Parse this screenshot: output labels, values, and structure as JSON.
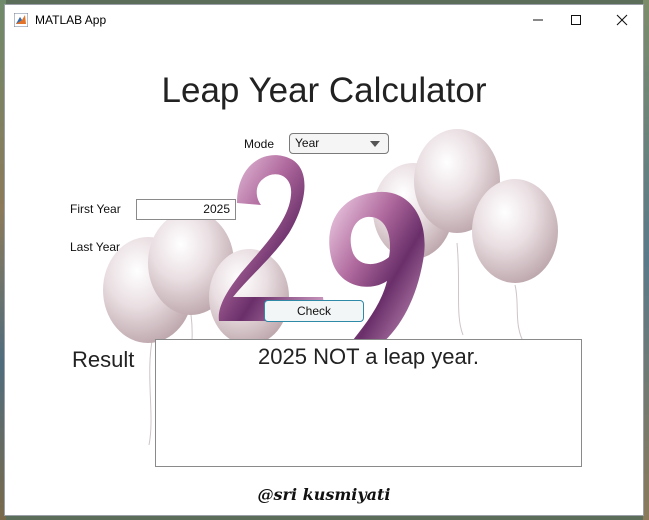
{
  "window": {
    "title": "MATLAB App",
    "controls": {
      "minimize": "minimize-icon",
      "maximize": "maximize-icon",
      "close": "close-icon"
    }
  },
  "app": {
    "title": "Leap Year Calculator",
    "mode": {
      "label": "Mode",
      "selected": "Year"
    },
    "first_year": {
      "label": "First Year",
      "value": "2025"
    },
    "last_year": {
      "label": "Last Year"
    },
    "check_button": "Check",
    "result": {
      "label": "Result",
      "text": "2025 NOT a leap year."
    },
    "signature": "@sri kusmiyati",
    "decoration": {
      "number": "29"
    }
  },
  "colors": {
    "button_border": "#2f8aa8",
    "balloon": "#e9dfe2",
    "number_art": "#b06a9e"
  }
}
